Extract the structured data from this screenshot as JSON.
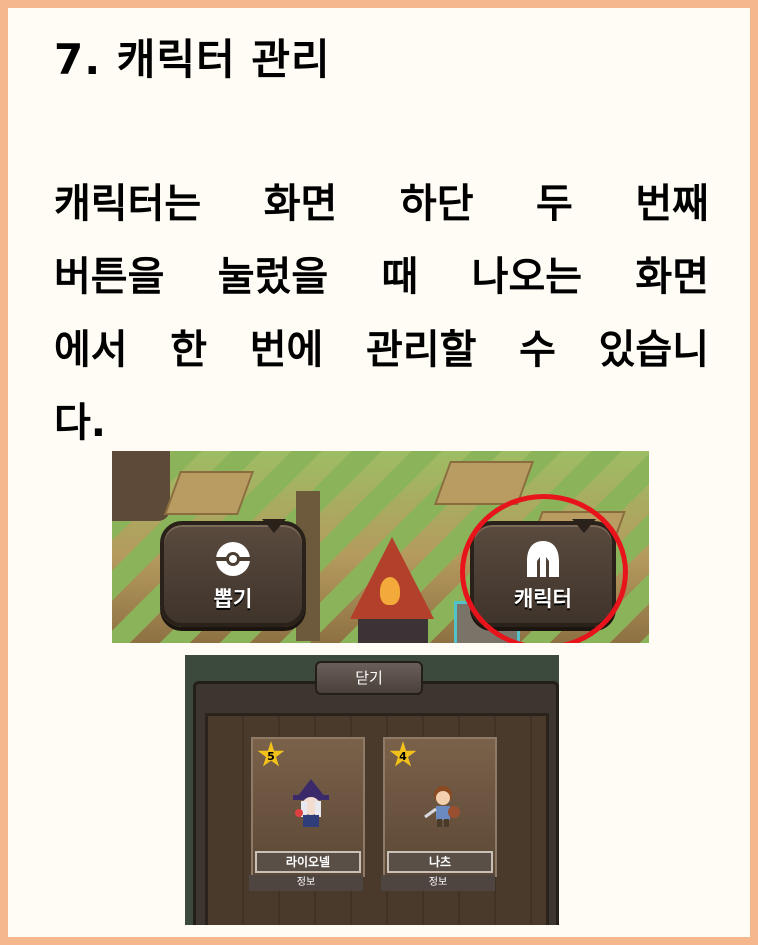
{
  "heading": "7. 캐릭터 관리",
  "paragraph_lines": [
    " 캐릭터는 화면 하단 두 번째",
    "버튼을 눌렀을 때 나오는 화면",
    "에서 한 번에 관리할 수 있습니",
    "다."
  ],
  "game_menu": {
    "gacha_button_label": "뽑기",
    "character_button_label": "캐릭터"
  },
  "character_screen": {
    "close_label": "닫기",
    "cards": [
      {
        "name": "라이오넬",
        "stars": "5",
        "info_label": "정보"
      },
      {
        "name": "나츠",
        "stars": "4",
        "info_label": "정보"
      }
    ]
  },
  "colors": {
    "page_border": "#f4b88c",
    "highlight_circle": "#e8141b",
    "star": "#f3c21a"
  }
}
